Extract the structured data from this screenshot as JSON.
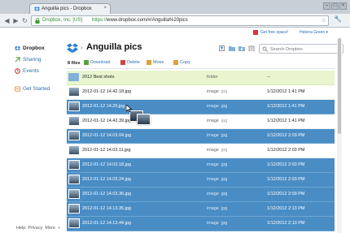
{
  "browser": {
    "tab_title": "Anguilla pics - Dropbox",
    "tab_close": "×",
    "url_org": "Dropbox, Inc. [US]",
    "url_scheme": "https://",
    "url_host": "www.dropbox.com/#/Anguilla%20pics",
    "back_icon": "back-arrow-icon",
    "forward_icon": "forward-arrow-icon",
    "reload_icon": "reload-icon"
  },
  "topbar": {
    "free_space": "Get free space!",
    "user": "Helena Green ▾"
  },
  "sidebar": {
    "items": [
      {
        "label": "Dropbox",
        "icon": "dropbox-icon",
        "color": "#2a6fb0"
      },
      {
        "label": "Sharing",
        "icon": "sharing-icon",
        "color": "#6aa84f"
      },
      {
        "label": "Events",
        "icon": "events-icon",
        "color": "#cc3333"
      },
      {
        "label": "Get Started",
        "icon": "get-started-icon",
        "color": "#e08a2c"
      }
    ],
    "footer": [
      "Help",
      "Privacy",
      "More",
      "»"
    ]
  },
  "header": {
    "title": "Anguilla pics",
    "crumb_sep": "›",
    "search_placeholder": "Search Dropbox"
  },
  "actions": {
    "count": "8 files",
    "download": "Download",
    "delete": "Delete",
    "move": "Move",
    "copy": "Copy"
  },
  "rows": [
    {
      "name": "2012 Best shots",
      "kind": "folder",
      "ext": "",
      "date": "--",
      "type": "folder"
    },
    {
      "name": "2012-01-12 14.42.18.jpg",
      "kind": "image",
      "ext": "jpg",
      "date": "1/12/2012 1:41 PM",
      "type": "normal"
    },
    {
      "name": "2012-01-12 14.26.jpg",
      "kind": "image",
      "ext": "jpg",
      "date": "1/12/2012 1:41 PM",
      "type": "selected"
    },
    {
      "name": "2012-01-12 14.42.39.jpg",
      "kind": "image",
      "ext": "jpg",
      "date": "1/12/2012 1:41 PM",
      "type": "normal"
    },
    {
      "name": "2012-01-12 14.03.04.jpg",
      "kind": "image",
      "ext": "jpg",
      "date": "1/12/2012 2:03 PM",
      "type": "selected"
    },
    {
      "name": "2012-01-12 14.03.11.jpg",
      "kind": "image",
      "ext": "jpg",
      "date": "1/12/2012 2:03 PM",
      "type": "normal"
    },
    {
      "name": "2012-01-12 14.03.18.jpg",
      "kind": "image",
      "ext": "jpg",
      "date": "1/12/2012 2:03 PM",
      "type": "selected"
    },
    {
      "name": "2012-01-12 14.03.24.jpg",
      "kind": "image",
      "ext": "jpg",
      "date": "1/12/2012 2:03 PM",
      "type": "selected"
    },
    {
      "name": "2012-01-12 14.03.36.jpg",
      "kind": "image",
      "ext": "jpg",
      "date": "1/12/2012 2:03 PM",
      "type": "selected"
    },
    {
      "name": "2012-01-12 14.13.35.jpg",
      "kind": "image",
      "ext": "jpg",
      "date": "1/12/2012 2:13 PM",
      "type": "selected"
    },
    {
      "name": "2012-01-12 14.13.44.jpg",
      "kind": "image",
      "ext": "jpg",
      "date": "1/12/2012 2:13 PM",
      "type": "selected"
    }
  ],
  "colors": {
    "selection": "#4a8dc5",
    "folder_row": "#e8f5cf",
    "link": "#2a6fb0"
  }
}
